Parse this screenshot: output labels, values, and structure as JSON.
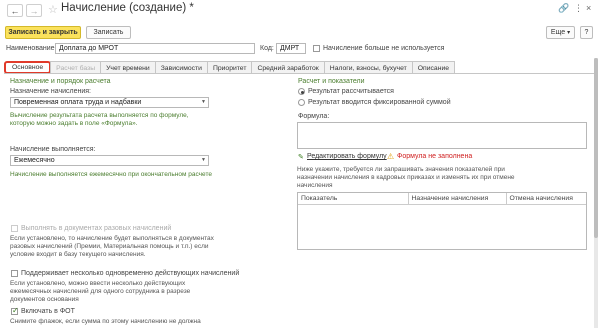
{
  "window": {
    "title": "Начисление (создание) *",
    "back_icon": "←",
    "forward_icon": "→",
    "star_icon": "☆",
    "link_icon": "🔗",
    "more_icon": "⋮",
    "restore_icon": "□",
    "close_icon": "×"
  },
  "toolbar": {
    "save_close_label": "Записать и закрыть",
    "save_label": "Записать",
    "more_label": "Еще",
    "more_arrow": "▾",
    "help_label": "?"
  },
  "header": {
    "name_label": "Наименование:",
    "name_value": "Доплата до МРОТ",
    "code_label": "Код:",
    "code_value": "ДМРТ",
    "unused_label": "Начисление больше не используется"
  },
  "tabs": [
    {
      "label": "Основное",
      "state": "active"
    },
    {
      "label": "Расчет базы",
      "state": "disabled"
    },
    {
      "label": "Учет времени",
      "state": "normal"
    },
    {
      "label": "Зависимости",
      "state": "normal"
    },
    {
      "label": "Приоритет",
      "state": "normal"
    },
    {
      "label": "Средний заработок",
      "state": "normal"
    },
    {
      "label": "Налоги, взносы, бухучет",
      "state": "normal"
    },
    {
      "label": "Описание",
      "state": "normal"
    }
  ],
  "left": {
    "section_title": "Назначение и порядок расчета",
    "purpose_label": "Назначение начисления:",
    "purpose_value": "Повременная оплата труда и надбавки",
    "purpose_hint": "Вычисление результата расчета выполняется по формуле, которую можно задать в поле «Формула».",
    "performed_label": "Начисление выполняется:",
    "performed_value": "Ежемесячно",
    "performed_hint": "Начисление выполняется ежемесячно при окончательном расчете",
    "one_time_label": "Выполнять в документах разовых начислений",
    "one_time_hint": "Если установлено, то начисление будет выполняться в документах разовых начислений (Премии, Материальная помощь и т.п.) если условие входит в базу текущего начисления.",
    "multi_label": "Поддерживает несколько одновременно действующих начислений",
    "multi_hint": "Если установлено, можно ввести несколько действующих ежемесячных начислений для одного сотрудника в разрезе документов основания",
    "fot_label": "Включать в ФОТ",
    "fot_hint": "Снимите флажок, если сумма по этому начислению не должна"
  },
  "right": {
    "section_title": "Расчет и показатели",
    "radio_calc": "Результат рассчитывается",
    "radio_fixed": "Результат вводится фиксированной суммой",
    "formula_label": "Формула:",
    "edit_formula": "Редактировать формулу",
    "formula_warning": "Формула не заполнена",
    "indicators_hint": "Ниже укажите, требуется ли запрашивать значения показателей при назначении начисления в кадровых приказах и изменять их при отмене начисления",
    "columns": [
      "Показатель",
      "Назначение начисления",
      "Отмена начисления"
    ]
  },
  "colors": {
    "primary_button": "#fbe25c",
    "hint_green": "#4a7d2e",
    "warning": "#d02020",
    "active_tab_outline": "#e03a2a"
  }
}
